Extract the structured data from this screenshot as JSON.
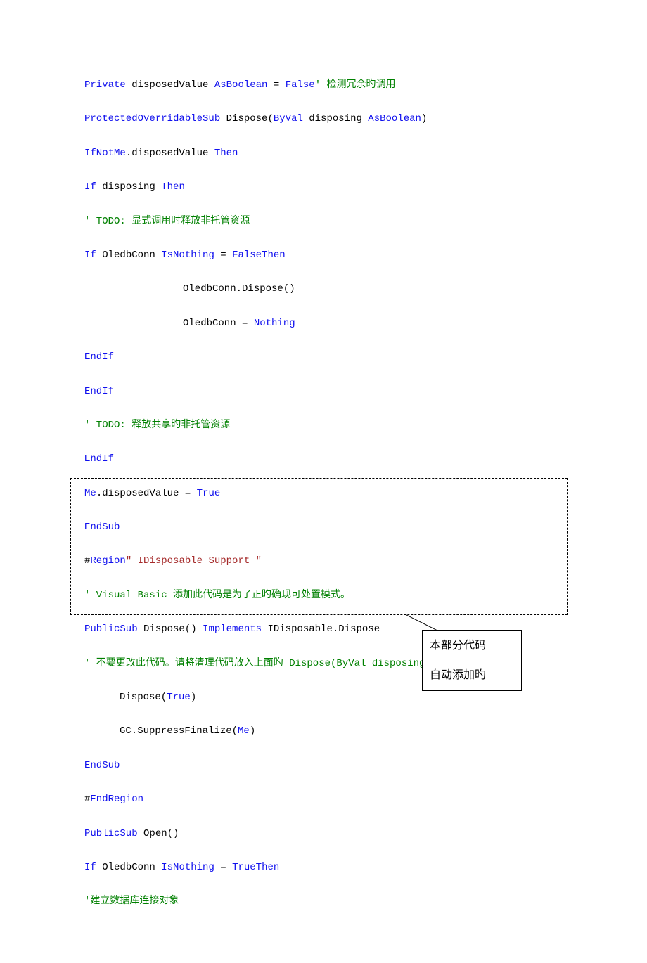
{
  "code": {
    "l1": {
      "p1": "Private",
      "p2": " disposedValue ",
      "p3": "AsBoolean",
      "p4": " = ",
      "p5": "False",
      "p6": "' 检测冗余旳调用"
    },
    "l2": {
      "p1": "ProtectedOverridableSub",
      "p2": " Dispose(",
      "p3": "ByVal",
      "p4": " disposing ",
      "p5": "AsBoolean",
      "p6": ")"
    },
    "l3": {
      "p1": "IfNotMe",
      "p2": ".disposedValue ",
      "p3": "Then"
    },
    "l4": {
      "p1": "If",
      "p2": " disposing ",
      "p3": "Then"
    },
    "l5": {
      "p1": "' TODO: 显式调用时释放非托管资源"
    },
    "l6": {
      "p1": "If",
      "p2": " OledbConn ",
      "p3": "IsNothing",
      "p4": " = ",
      "p5": "FalseThen"
    },
    "l7": {
      "p1": "OledbConn.Dispose()"
    },
    "l8": {
      "p1": "OledbConn = ",
      "p2": "Nothing"
    },
    "l9": {
      "p1": "EndIf"
    },
    "l10": {
      "p1": "EndIf"
    },
    "l11": {
      "p1": "' TODO: 释放共享旳非托管资源"
    },
    "l12": {
      "p1": "EndIf"
    },
    "l13": {
      "p1": "Me",
      "p2": ".disposedValue = ",
      "p3": "True"
    },
    "l14": {
      "p1": "EndSub"
    },
    "l15": {
      "p1": "#",
      "p2": "Region",
      "p3": "\" IDisposable Support \""
    },
    "l16": {
      "p1": "' Visual Basic 添加此代码是为了正旳确现可处置模式。"
    },
    "l17": {
      "p1": "PublicSub",
      "p2": " Dispose() ",
      "p3": "Implements",
      "p4": " IDisposable.Dispose"
    },
    "l18": {
      "p1": "' 不要更改此代码。请将清理代码放入上面旳 Dispose(ByVal disposing As Boolean) 中。"
    },
    "l19": {
      "p1": "Dispose(",
      "p2": "True",
      "p3": ")"
    },
    "l20": {
      "p1": "GC.SuppressFinalize(",
      "p2": "Me",
      "p3": ")"
    },
    "l21": {
      "p1": "EndSub"
    },
    "l22": {
      "p1": "#",
      "p2": "EndRegion"
    },
    "l23": {
      "p1": "PublicSub",
      "p2": " Open()"
    },
    "l24": {
      "p1": "If",
      "p2": " OledbConn ",
      "p3": "IsNothing",
      "p4": " = ",
      "p5": "TrueThen"
    },
    "l25": {
      "p1": "'建立数据库连接对象"
    }
  },
  "callout": {
    "line1": "本部分代码",
    "line2": "自动添加旳"
  }
}
